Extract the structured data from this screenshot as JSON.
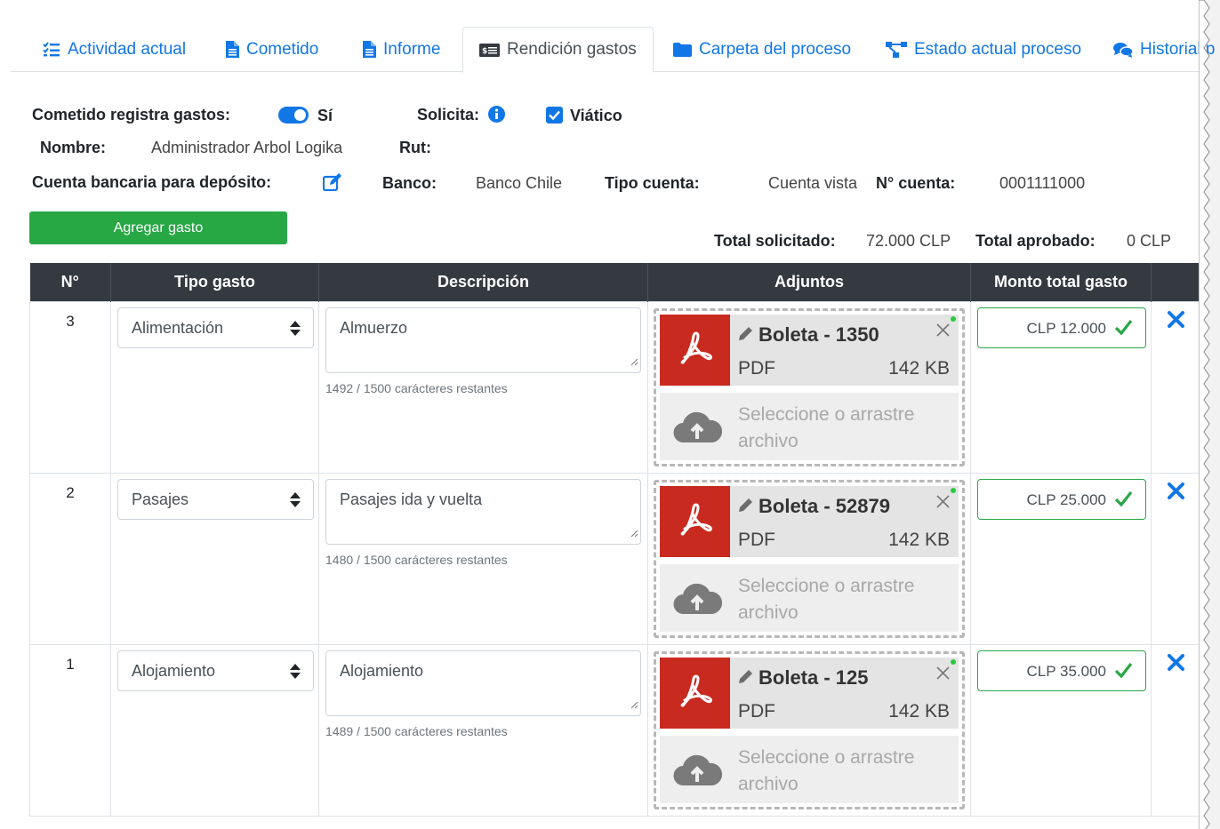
{
  "tabs": [
    {
      "label": "Actividad actual",
      "icon": "list-check-icon"
    },
    {
      "label": "Cometido",
      "icon": "document-icon"
    },
    {
      "label": "Informe",
      "icon": "document-icon"
    },
    {
      "label": "Rendición gastos",
      "icon": "money-bill-icon",
      "active": true
    },
    {
      "label": "Carpeta del proceso",
      "icon": "folder-icon"
    },
    {
      "label": "Estado actual proceso",
      "icon": "project-diagram-icon"
    },
    {
      "label": "Historial p",
      "icon": "comments-icon"
    }
  ],
  "form": {
    "registra_label": "Cometido registra gastos:",
    "registra_value": "Sí",
    "solicita_label": "Solicita:",
    "viatico_label": "Viático",
    "nombre_label": "Nombre:",
    "nombre_value": "Administrador Arbol Logika",
    "rut_label": "Rut:",
    "cuenta_label": "Cuenta bancaria para depósito:",
    "banco_label": "Banco:",
    "banco_value": "Banco Chile",
    "tipo_cuenta_label": "Tipo cuenta:",
    "tipo_cuenta_value": "Cuenta vista",
    "num_cuenta_label": "N° cuenta:",
    "num_cuenta_value": "0001111000",
    "add_button": "Agregar gasto",
    "total_solicitado_label": "Total solicitado:",
    "total_solicitado_value": "72.000 CLP",
    "total_aprobado_label": "Total aprobado:",
    "total_aprobado_value": "0 CLP"
  },
  "table": {
    "headers": [
      "N°",
      "Tipo gasto",
      "Descripción",
      "Adjuntos",
      "Monto total gasto",
      ""
    ],
    "rows": [
      {
        "num": "3",
        "tipo": "Alimentación",
        "descripcion": "Almuerzo",
        "chars": "1492 / 1500 carácteres restantes",
        "file_name": "Boleta - 1350",
        "file_type": "PDF",
        "file_size": "142 KB",
        "upload_text": "Seleccione o arrastre archivo",
        "monto": "CLP 12.000"
      },
      {
        "num": "2",
        "tipo": "Pasajes",
        "descripcion": "Pasajes ida y vuelta",
        "chars": "1480 / 1500 carácteres restantes",
        "file_name": "Boleta - 52879",
        "file_type": "PDF",
        "file_size": "142 KB",
        "upload_text": "Seleccione o arrastre archivo",
        "monto": "CLP 25.000"
      },
      {
        "num": "1",
        "tipo": "Alojamiento",
        "descripcion": "Alojamiento",
        "chars": "1489 / 1500 carácteres restantes",
        "file_name": "Boleta - 125",
        "file_type": "PDF",
        "file_size": "142 KB",
        "upload_text": "Seleccione o arrastre archivo",
        "monto": "CLP 35.000"
      }
    ]
  },
  "colors": {
    "primary": "#1277e6",
    "success": "#28a745",
    "header_dark": "#343a40",
    "pdf_red": "#c92a1f"
  }
}
